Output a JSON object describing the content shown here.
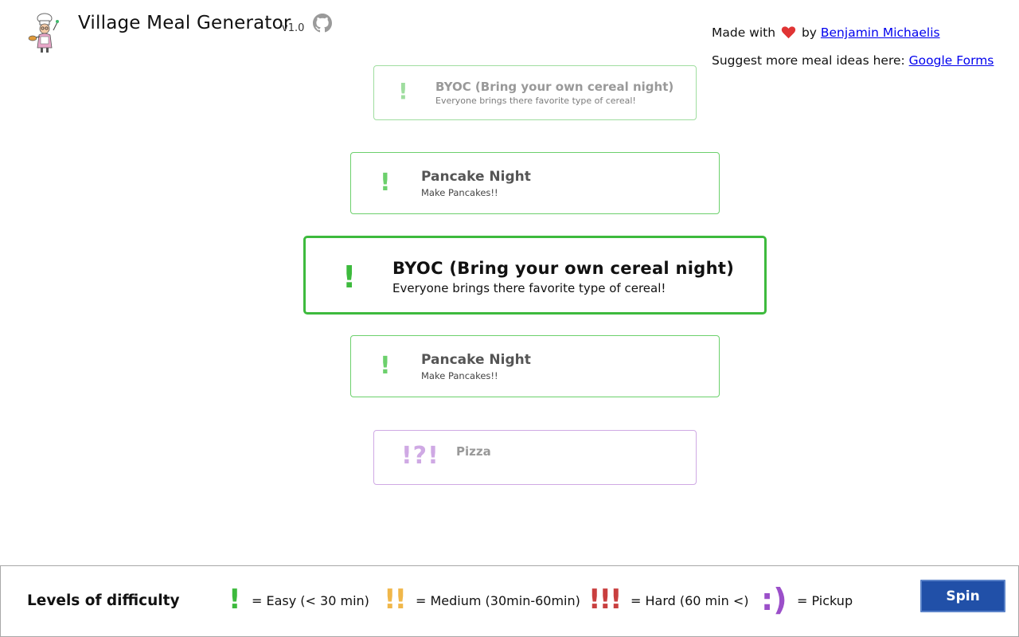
{
  "header": {
    "title": "Village Meal Generator",
    "version": "v1.0",
    "logo_icon": "chef-grandma-logo",
    "github_icon": "github-icon"
  },
  "credits": {
    "made_with_prefix": "Made with",
    "made_with_by": "by",
    "author_link": "Benjamin Michaelis",
    "suggest_prefix": "Suggest more meal ideas here:",
    "suggest_link": "Google Forms",
    "heart_icon": "heart-icon"
  },
  "meals": [
    {
      "mark": "!",
      "title": "BYOC (Bring your own cereal night)",
      "description": "Everyone brings there favorite type of cereal!"
    },
    {
      "mark": "!",
      "title": "Pancake Night",
      "description": "Make Pancakes!!"
    },
    {
      "mark": "!",
      "title": "BYOC (Bring your own cereal night)",
      "description": "Everyone brings there favorite type of cereal!"
    },
    {
      "mark": "!",
      "title": "Pancake Night",
      "description": "Make Pancakes!!"
    },
    {
      "mark": "!?!",
      "title": "Pizza",
      "description": ""
    }
  ],
  "legend": {
    "title": "Levels of difficulty",
    "items": [
      {
        "mark": "!",
        "text": "= Easy (< 30 min)",
        "color": "#3dba3d"
      },
      {
        "mark": "!!",
        "text": "= Medium (30min-60min)",
        "color": "#f0b74a"
      },
      {
        "mark": "!!!",
        "text": "= Hard (60 min <)",
        "color": "#c93f3f"
      },
      {
        "mark": ":)",
        "text": "= Pickup",
        "color": "#9b4fc9"
      }
    ]
  },
  "spin_button": {
    "label": "Spin",
    "color": "#2150a8"
  },
  "colors": {
    "easy_green": "#3dba3d",
    "pickup_purple": "#9b4fc9",
    "link_blue": "#0000ee"
  }
}
